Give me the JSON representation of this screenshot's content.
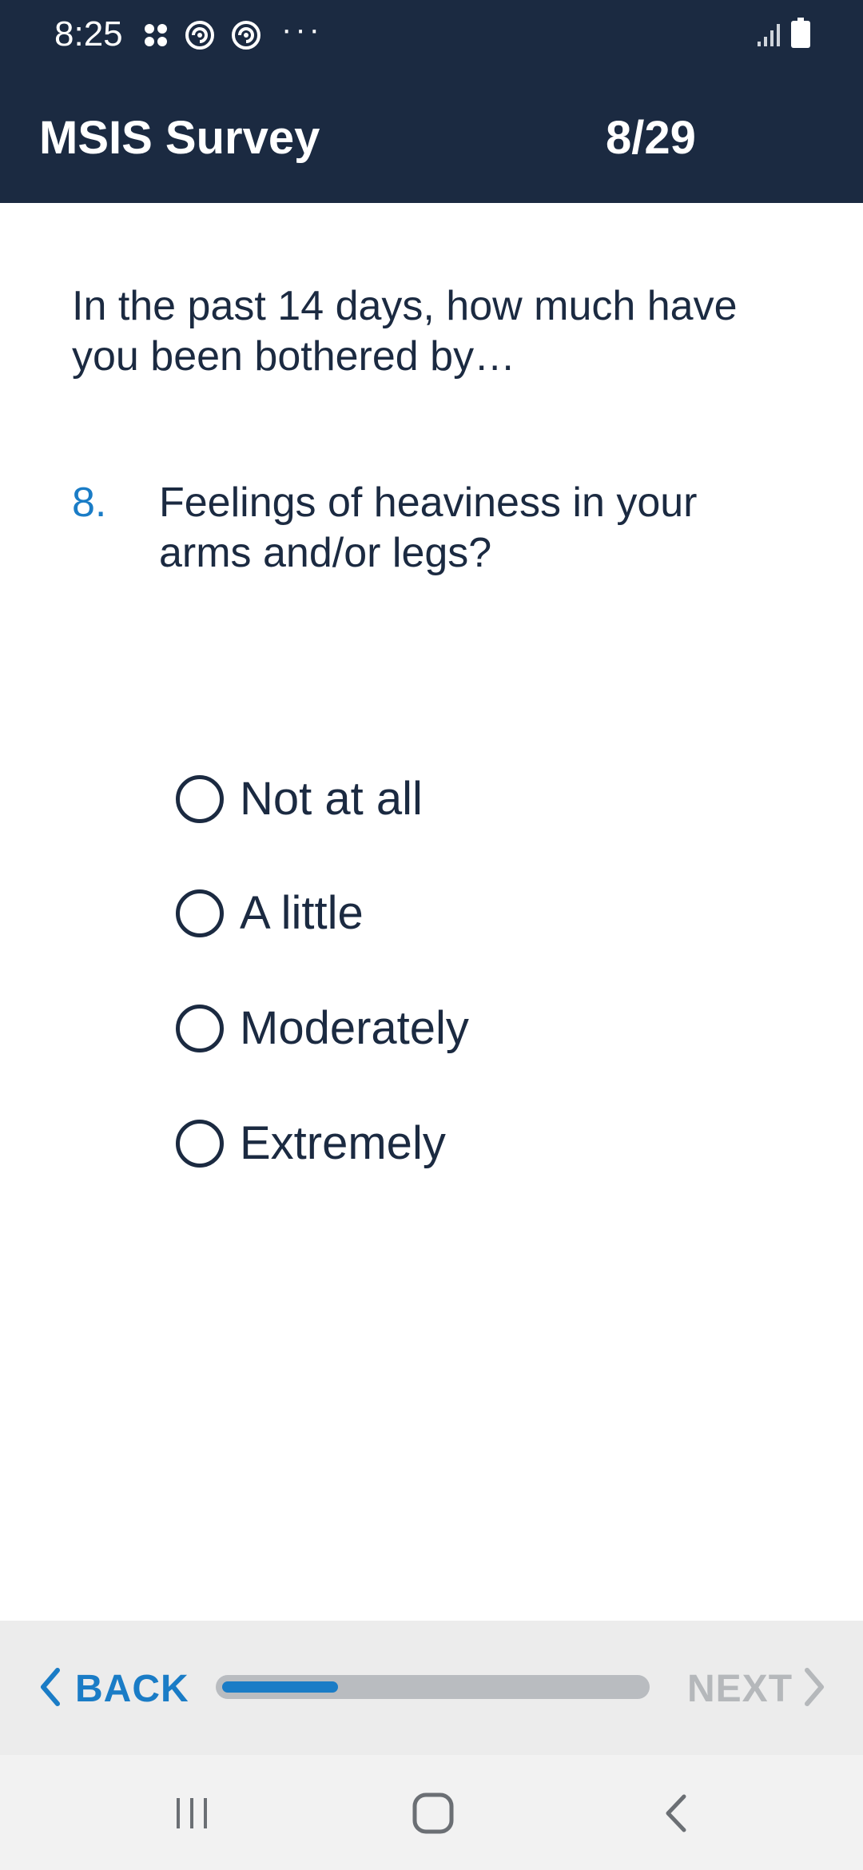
{
  "status_bar": {
    "time": "8:25",
    "notification_dots": "···",
    "icons": [
      "apps-grid-icon",
      "sync-icon",
      "sync-icon",
      "more-dots-icon",
      "signal-icon",
      "battery-icon"
    ]
  },
  "header": {
    "title": "MSIS Survey",
    "progress_count": "8/29"
  },
  "question": {
    "intro": "In the past 14 days, how much have you been bothered by…",
    "number": "8.",
    "text": "Feelings of heaviness in your arms and/or legs?"
  },
  "options": [
    {
      "label": "Not at all",
      "selected": false
    },
    {
      "label": "A little",
      "selected": false
    },
    {
      "label": "Moderately",
      "selected": false
    },
    {
      "label": "Extremely",
      "selected": false
    }
  ],
  "footer": {
    "back_label": "BACK",
    "next_label": "NEXT",
    "progress_fraction": 0.276,
    "next_enabled": false
  },
  "colors": {
    "header_bg": "#1b2a41",
    "accent": "#1a7cc6",
    "text_dark": "#1b2a41",
    "disabled": "#b5b8bb",
    "track": "#b9bcc0"
  },
  "system_nav": [
    "recent-apps-icon",
    "home-icon",
    "back-icon"
  ]
}
